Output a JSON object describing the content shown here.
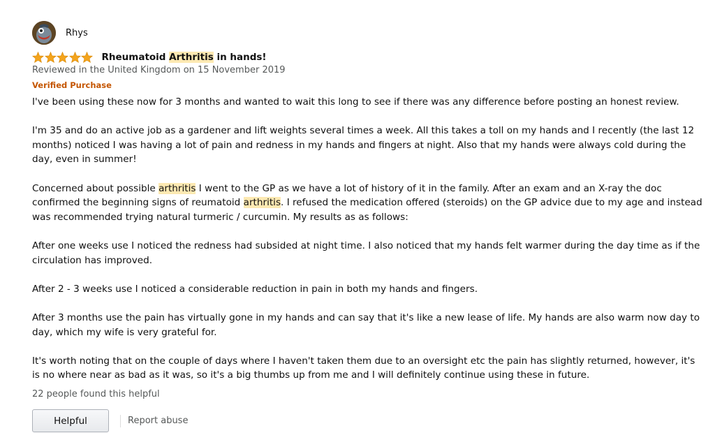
{
  "review": {
    "reviewer_name": "Rhys",
    "rating": 5,
    "max_rating": 5,
    "title": {
      "before": "Rheumatoid ",
      "highlight": "Arthritis",
      "after": " in hands!"
    },
    "meta": "Reviewed in the United Kingdom on 15 November 2019",
    "verified_label": "Verified Purchase",
    "colors": {
      "star": "#f4a41c",
      "verified": "#c45500",
      "highlight": "#fde9b2",
      "meta_text": "#565959"
    },
    "body": {
      "p1": "I've been using these now for 3 months and wanted to wait this long to see if there was any difference before posting an honest review.",
      "p2": "I'm 35 and do an active job as a gardener and lift weights several times a week. All this takes a toll on my hands and I recently (the last 12 months) noticed I was having a lot of pain and redness in my hands and fingers at night. Also that my hands were always cold during the day, even in summer!",
      "p3": {
        "part1": "Concerned about possible ",
        "hl1": "arthritis",
        "part2": " I went to the GP as we have a lot of history of it in the family. After an exam and an X-ray the doc confirmed the beginning signs of reumatoid ",
        "hl2": "arthritis",
        "part3": ". I refused the medication offered (steroids) on the GP advice due to my age and instead was recommended trying natural turmeric / curcumin. My results as as follows:"
      },
      "p4": "After one weeks use I noticed the redness had subsided at night time. I also noticed that my hands felt warmer during the day time as if the circulation has improved.",
      "p5": "After 2 - 3 weeks use I noticed a considerable reduction in pain in both my hands and fingers.",
      "p6": "After 3 months use the pain has virtually gone in my hands and can say that it's like a new lease of life. My hands are also warm now day to day, which my wife is very grateful for.",
      "p7": "It's worth noting that on the couple of days where I haven't taken them due to an oversight etc the pain has slightly returned, however, it's is no where near as bad as it was, so it's a big thumbs up from me and I will definitely continue using these in future."
    },
    "helpful_count_text": "22 people found this helpful",
    "helpful_button_label": "Helpful",
    "report_abuse_label": "Report abuse",
    "icons": {
      "avatar": "avatar-icon",
      "star": "star-icon"
    }
  }
}
